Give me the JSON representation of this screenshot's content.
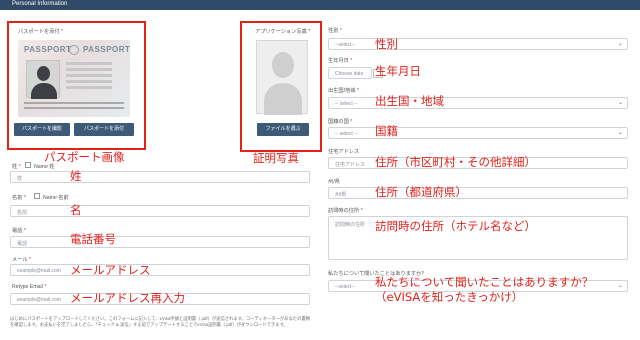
{
  "header": {
    "title": "Personal Information"
  },
  "passport": {
    "label": "パスポートを添付",
    "title_left": "PASSPORT",
    "title_right": "PASSPORT",
    "btn_take": "パスポートを撮影",
    "btn_attach": "パスポートを添付",
    "annotation": "パスポート画像"
  },
  "photo": {
    "label": "アプリケーション写真",
    "btn": "ファイルを選ぶ",
    "annotation": "証明写真"
  },
  "left_fields": {
    "surname": {
      "label": "姓",
      "noname": "Name 姓",
      "placeholder": "姓",
      "annotation": "姓"
    },
    "given": {
      "label": "名前",
      "noname": "Name 名前",
      "placeholder": "名前",
      "annotation": "名"
    },
    "phone": {
      "label": "電話",
      "placeholder": "電話",
      "annotation": "電話番号"
    },
    "email": {
      "label": "メール",
      "placeholder": "example@mail.com",
      "annotation": "メールアドレス"
    },
    "retype": {
      "label": "Retype Email",
      "placeholder": "example@mail.com",
      "annotation": "メールアドレス再入力"
    }
  },
  "right_fields": {
    "gender": {
      "label": "性別",
      "value": "--select--",
      "annotation": "性別"
    },
    "dob": {
      "label": "生年月日",
      "placeholder": "Choose date",
      "annotation": "生年月日"
    },
    "birth_country": {
      "label": "出生国/地域",
      "value": "-- select --",
      "annotation": "出生国・地域"
    },
    "nationality": {
      "label": "国籍の国",
      "value": "-- select --",
      "annotation": "国籍"
    },
    "address": {
      "label": "住宅アドレス",
      "placeholder": "住宅アドレス",
      "annotation": "住所（市区町村・その他詳細）"
    },
    "state": {
      "label": "州/県",
      "placeholder": "州/県",
      "annotation": "住所（都道府県）"
    },
    "visit_address": {
      "label": "訪問時の住所",
      "placeholder": "訪問時の住所",
      "annotation": "訪問時の住所（ホテル名など）"
    },
    "heard": {
      "label": "私たちについて聞いたことはありますか？",
      "value": "--select--",
      "annotation_1": "私たちについて聞いたことはありますか？",
      "annotation_2": "（eVISAを知ったきっかけ）"
    }
  },
  "footer_note": "はじめにパスポートをアップロードしてください。このフォームに記入して、eVisa申請と証明書（.pdf）が送信されます。コーディネーターがあなたの書類を確認します。お支払いを完了しましたら、「チェック & 送信」する前でアップデートすることでeVisa証明書（.pdf）がダウンロードできます。"
}
